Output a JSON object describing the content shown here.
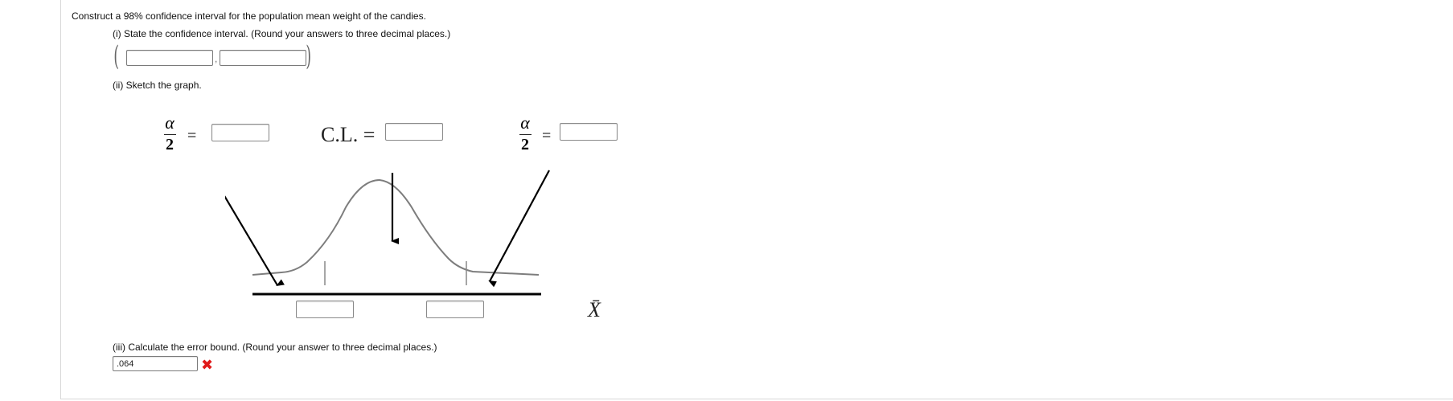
{
  "question": {
    "prompt": "Construct a 98% confidence interval for the population mean weight of the candies."
  },
  "part_i": {
    "label": "(i) State the confidence interval. (Round your answers to three decimal places.)",
    "lower_value": "",
    "upper_value": "",
    "separator": ",",
    "open_paren": "(",
    "close_paren": ")"
  },
  "part_ii": {
    "label": "(ii) Sketch the graph.",
    "alpha_symbol": "α",
    "two": "2",
    "equals": "=",
    "cl_label": "C.L. =",
    "x_axis_label": "X̄",
    "alpha_left_value": "",
    "cl_value": "",
    "alpha_right_value": "",
    "lower_bound_value": "",
    "upper_bound_value": ""
  },
  "part_iii": {
    "label": "(iii) Calculate the error bound. (Round your answer to three decimal places.)",
    "answer_value": ".064",
    "status": "incorrect",
    "status_color": "#e01a1a",
    "status_icon": "x-icon"
  }
}
